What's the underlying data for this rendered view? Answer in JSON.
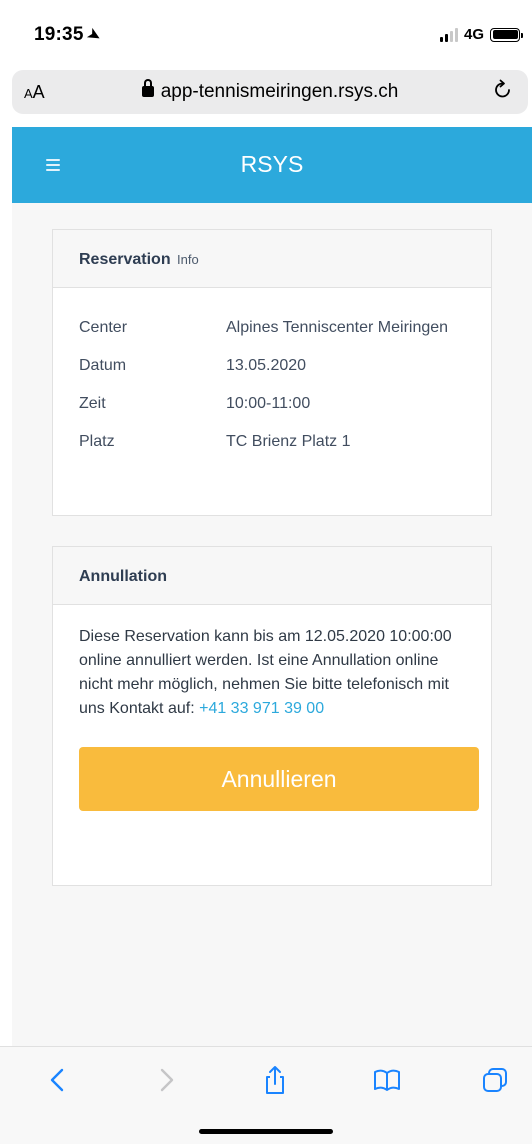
{
  "status_bar": {
    "time": "19:35",
    "network": "4G"
  },
  "browser": {
    "text_size": "AA",
    "url": "app-tennismeiringen.rsys.ch"
  },
  "app": {
    "brand": "RSYS"
  },
  "reservation": {
    "title": "Reservation",
    "subtitle": "Info",
    "rows": [
      {
        "label": "Center",
        "value": "Alpines Tenniscenter Meiringen"
      },
      {
        "label": "Datum",
        "value": "13.05.2020"
      },
      {
        "label": "Zeit",
        "value": "10:00-11:00"
      },
      {
        "label": "Platz",
        "value": "TC Brienz Platz 1"
      }
    ]
  },
  "cancellation": {
    "title": "Annullation",
    "text": "Diese Reservation kann bis am 12.05.2020 10:00:00 online annulliert werden. Ist eine Annullation online nicht mehr möglich, nehmen Sie bitte telefonisch mit uns Kontakt auf:",
    "phone": "+41 33 971 39 00",
    "button": "Annullieren"
  },
  "colors": {
    "header": "#2ca9dc",
    "button": "#f9bb3d",
    "link": "#2ca9dc"
  },
  "icons": [
    "location-arrow-icon",
    "signal-icon",
    "battery-icon",
    "lock-icon",
    "reload-icon",
    "menu-icon",
    "back-icon",
    "forward-icon",
    "share-icon",
    "bookmarks-icon",
    "tabs-icon"
  ]
}
